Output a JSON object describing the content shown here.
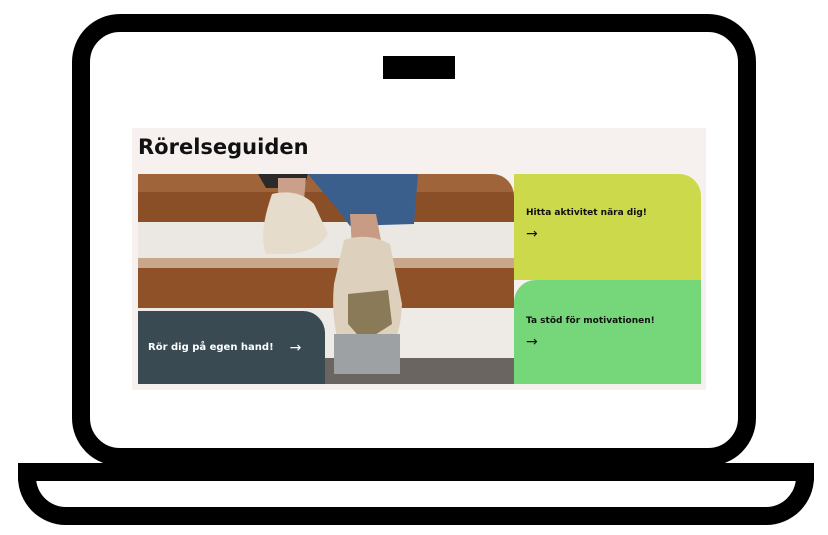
{
  "page": {
    "title": "Rörelseguiden"
  },
  "cards": {
    "own": {
      "label": "Rör dig på egen hand!",
      "arrow": "→",
      "color": "#3a4a52"
    },
    "activity": {
      "label": "Hitta aktivitet nära dig!",
      "arrow": "→",
      "color": "#cbd94a"
    },
    "motivation": {
      "label": "Ta stöd för motivationen!",
      "arrow": "→",
      "color": "#76d77a"
    }
  },
  "icons": {
    "arrow": "right-arrow-icon"
  }
}
